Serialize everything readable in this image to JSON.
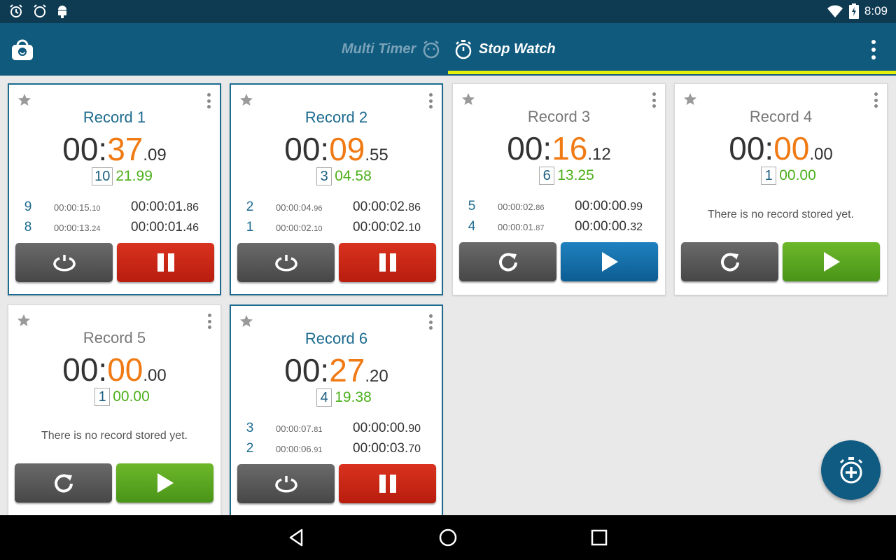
{
  "status_bar": {
    "left_icons": [
      "alarm-icon",
      "alarm-outline-icon",
      "android-icon"
    ],
    "right_icons": [
      "wifi-icon",
      "battery-charging-icon"
    ],
    "time": "8:09"
  },
  "app_bar": {
    "shop_icon": "shopping-bag-icon",
    "tabs": [
      {
        "label": "Multi Timer",
        "icon": "timer-face-icon",
        "selected": false
      },
      {
        "label": "Stop Watch",
        "icon": "stopwatch-icon",
        "selected": true
      }
    ],
    "menu_icon": "overflow-menu-icon",
    "accent_color": "#e4f00a"
  },
  "cards": [
    {
      "title": "Record 1",
      "active": true,
      "time": {
        "min": "00",
        "colon": ":",
        "sec": "37",
        "cs": ".09"
      },
      "lap_count": "10",
      "lap_time": "21.99",
      "records": [
        {
          "index": "9",
          "sub_main": "00:00:15.",
          "sub_cs": "10",
          "total_main": "00:00:01.",
          "total_cs": "86"
        },
        {
          "index": "8",
          "sub_main": "00:00:13.",
          "sub_cs": "24",
          "total_main": "00:00:01.",
          "total_cs": "46"
        }
      ],
      "empty_message": "",
      "left_button": "lap-icon",
      "right_button": "pause-icon",
      "right_color": "red"
    },
    {
      "title": "Record 2",
      "active": true,
      "time": {
        "min": "00",
        "colon": ":",
        "sec": "09",
        "cs": ".55"
      },
      "lap_count": "3",
      "lap_time": "04.58",
      "records": [
        {
          "index": "2",
          "sub_main": "00:00:04.",
          "sub_cs": "96",
          "total_main": "00:00:02.",
          "total_cs": "86"
        },
        {
          "index": "1",
          "sub_main": "00:00:02.",
          "sub_cs": "10",
          "total_main": "00:00:02.",
          "total_cs": "10"
        }
      ],
      "empty_message": "",
      "left_button": "lap-icon",
      "right_button": "pause-icon",
      "right_color": "red"
    },
    {
      "title": "Record 3",
      "active": false,
      "time": {
        "min": "00",
        "colon": ":",
        "sec": "16",
        "cs": ".12"
      },
      "lap_count": "6",
      "lap_time": "13.25",
      "records": [
        {
          "index": "5",
          "sub_main": "00:00:02.",
          "sub_cs": "86",
          "total_main": "00:00:00.",
          "total_cs": "99"
        },
        {
          "index": "4",
          "sub_main": "00:00:01.",
          "sub_cs": "87",
          "total_main": "00:00:00.",
          "total_cs": "32"
        }
      ],
      "empty_message": "",
      "left_button": "reset-icon",
      "right_button": "play-icon",
      "right_color": "blue"
    },
    {
      "title": "Record 4",
      "active": false,
      "time": {
        "min": "00",
        "colon": ":",
        "sec": "00",
        "cs": ".00"
      },
      "lap_count": "1",
      "lap_time": "00.00",
      "records": [],
      "empty_message": "There is no record stored yet.",
      "left_button": "reset-icon",
      "right_button": "play-icon",
      "right_color": "green"
    },
    {
      "title": "Record 5",
      "active": false,
      "time": {
        "min": "00",
        "colon": ":",
        "sec": "00",
        "cs": ".00"
      },
      "lap_count": "1",
      "lap_time": "00.00",
      "records": [],
      "empty_message": "There is no record stored yet.",
      "left_button": "reset-icon",
      "right_button": "play-icon",
      "right_color": "green"
    },
    {
      "title": "Record 6",
      "active": true,
      "time": {
        "min": "00",
        "colon": ":",
        "sec": "27",
        "cs": ".20"
      },
      "lap_count": "4",
      "lap_time": "19.38",
      "records": [
        {
          "index": "3",
          "sub_main": "00:00:07.",
          "sub_cs": "81",
          "total_main": "00:00:00.",
          "total_cs": "90"
        },
        {
          "index": "2",
          "sub_main": "00:00:06.",
          "sub_cs": "91",
          "total_main": "00:00:03.",
          "total_cs": "70"
        }
      ],
      "empty_message": "",
      "left_button": "lap-icon",
      "right_button": "pause-icon",
      "right_color": "red"
    }
  ],
  "fab": {
    "icon": "add-stopwatch-icon"
  },
  "nav_bar": {
    "buttons": [
      "back-icon",
      "home-icon",
      "recents-icon"
    ]
  }
}
